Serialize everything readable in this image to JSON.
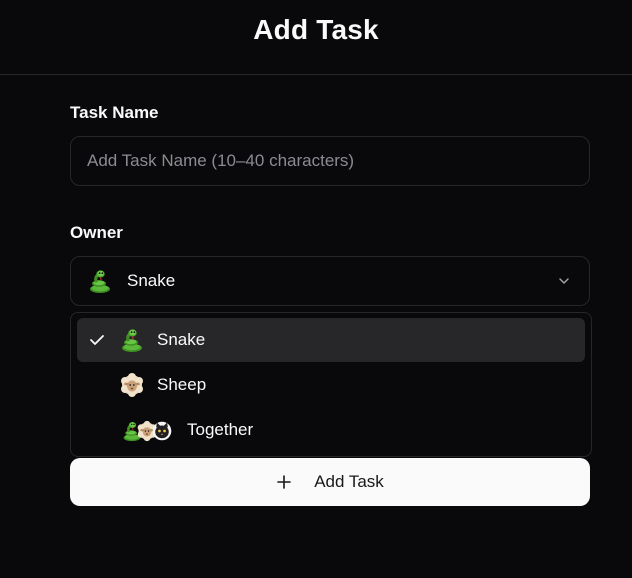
{
  "header": {
    "title": "Add Task"
  },
  "form": {
    "task_name_label": "Task Name",
    "task_name_value": "",
    "task_name_placeholder": "Add Task Name (10–40 characters)",
    "owner_label": "Owner",
    "owner_selected": "Snake",
    "owner_selected_icon": "snake-emoji"
  },
  "owner_options": [
    {
      "label": "Snake",
      "icon": "snake-emoji",
      "selected": true
    },
    {
      "label": "Sheep",
      "icon": "sheep-emoji",
      "selected": false
    },
    {
      "label": "Together",
      "icon": "snake-sheep-cat-emoji",
      "selected": false
    }
  ],
  "actions": {
    "add_task_label": "Add Task"
  },
  "colors": {
    "background": "#09090b",
    "border": "#27272a",
    "selected_option": "#27272a",
    "primary_button": "#fafafa",
    "primary_button_text": "#18181b",
    "text": "#fafafa",
    "placeholder": "#8b8b93"
  }
}
